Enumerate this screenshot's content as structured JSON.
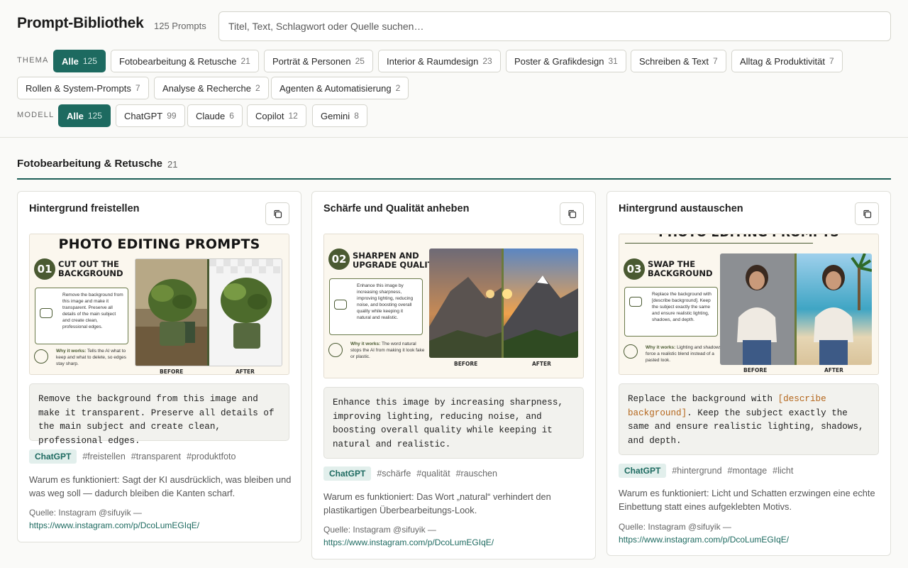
{
  "header": {
    "title": "Prompt-Bibliothek",
    "count": "125 Prompts",
    "search_placeholder": "Titel, Text, Schlagwort oder Quelle suchen…"
  },
  "filters": {
    "theme_label": "THEMA",
    "theme_chips": [
      {
        "label": "Alle",
        "count": "125",
        "active": true
      },
      {
        "label": "Fotobearbeitung & Retusche",
        "count": "21"
      },
      {
        "label": "Porträt & Personen",
        "count": "25"
      },
      {
        "label": "Interior & Raumdesign",
        "count": "23"
      },
      {
        "label": "Poster & Grafikdesign",
        "count": "31"
      },
      {
        "label": "Schreiben & Text",
        "count": "7"
      },
      {
        "label": "Alltag & Produktivität",
        "count": "7"
      },
      {
        "label": "Rollen & System-Prompts",
        "count": "7"
      },
      {
        "label": "Analyse & Recherche",
        "count": "2"
      },
      {
        "label": "Agenten & Automatisierung",
        "count": "2"
      }
    ],
    "model_label": "MODELL",
    "model_chips": [
      {
        "label": "Alle",
        "count": "125",
        "active": true
      },
      {
        "label": "ChatGPT",
        "count": "99"
      },
      {
        "label": "Claude",
        "count": "6"
      },
      {
        "label": "Copilot",
        "count": "12"
      },
      {
        "label": "Gemini",
        "count": "8"
      }
    ]
  },
  "section": {
    "title": "Fotobearbeitung & Retusche",
    "count": "21"
  },
  "cards": [
    {
      "title": "Hintergrund freistellen",
      "thumb": {
        "heading": "PHOTO EDITING PROMPTS",
        "num": "01",
        "step_line1": "CUT OUT THE",
        "step_line2": "BACKGROUND",
        "desc": "Remove the background from this image and make it transparent. Preserve all details of the main subject and create clean, professional edges.",
        "why_label": "Why it works:",
        "why_text": "Tells the AI what to keep and what to delete, so edges stay sharp.",
        "before": "BEFORE",
        "after": "AFTER"
      },
      "prompt": "Remove the background from this image and make it transparent. Preserve all details of the main subject and create clean, professional edges.",
      "model": "ChatGPT",
      "tags": [
        "#freistellen",
        "#transparent",
        "#produktfoto"
      ],
      "why": "Warum es funktioniert: Sagt der KI ausdrücklich, was bleiben und was weg soll — dadurch bleiben die Kanten scharf.",
      "source_label": "Quelle: Instagram @sifuyik —",
      "source_url": "https://www.instagram.com/p/DcoLumEGIqE/"
    },
    {
      "title": "Schärfe und Qualität anheben",
      "thumb": {
        "num": "02",
        "step_line1": "SHARPEN AND",
        "step_line2": "UPGRADE QUALITY",
        "desc": "Enhance this image by increasing sharpness, improving lighting, reducing noise, and boosting overall quality while keeping it natural and realistic.",
        "why_label": "Why it works:",
        "why_text": "The word natural stops the AI from making it look fake or plastic.",
        "before": "BEFORE",
        "after": "AFTER"
      },
      "prompt": "Enhance this image by increasing sharpness, improving lighting, reducing noise, and boosting overall quality while keeping it natural and realistic.",
      "model": "ChatGPT",
      "tags": [
        "#schärfe",
        "#qualität",
        "#rauschen"
      ],
      "why": "Warum es funktioniert: Das Wort „natural“ verhindert den plastikartigen Überbearbeitungs-Look.",
      "source_label": "Quelle: Instagram @sifuyik —",
      "source_url": "https://www.instagram.com/p/DcoLumEGIqE/"
    },
    {
      "title": "Hintergrund austauschen",
      "thumb": {
        "heading": "PHOTO EDITING PROMPTS",
        "num": "03",
        "step_line1": "SWAP THE",
        "step_line2": "BACKGROUND",
        "desc": "Replace the background with [describe background]. Keep the subject exactly the same and ensure realistic lighting, shadows, and depth.",
        "why_label": "Why it works:",
        "why_text": "Lighting and shadows force a realistic blend instead of a pasted look.",
        "before": "BEFORE",
        "after": "AFTER"
      },
      "prompt_before": "Replace the background with ",
      "prompt_placeholder": "[describe background]",
      "prompt_after": ". Keep the subject exactly the same and ensure realistic lighting, shadows, and depth.",
      "model": "ChatGPT",
      "tags": [
        "#hintergrund",
        "#montage",
        "#licht"
      ],
      "why": "Warum es funktioniert: Licht und Schatten erzwingen eine echte Einbettung statt eines aufgeklebten Motivs.",
      "source_label": "Quelle: Instagram @sifuyik —",
      "source_url": "https://www.instagram.com/p/DcoLumEGIqE/"
    }
  ],
  "colors": {
    "accent": "#1d6a60",
    "olive": "#4a5a32",
    "placeholder_text": "#b4651a"
  },
  "icons": {
    "copy": "copy-icon",
    "chat": "chat-bubble-icon",
    "bulb": "lightbulb-icon"
  }
}
